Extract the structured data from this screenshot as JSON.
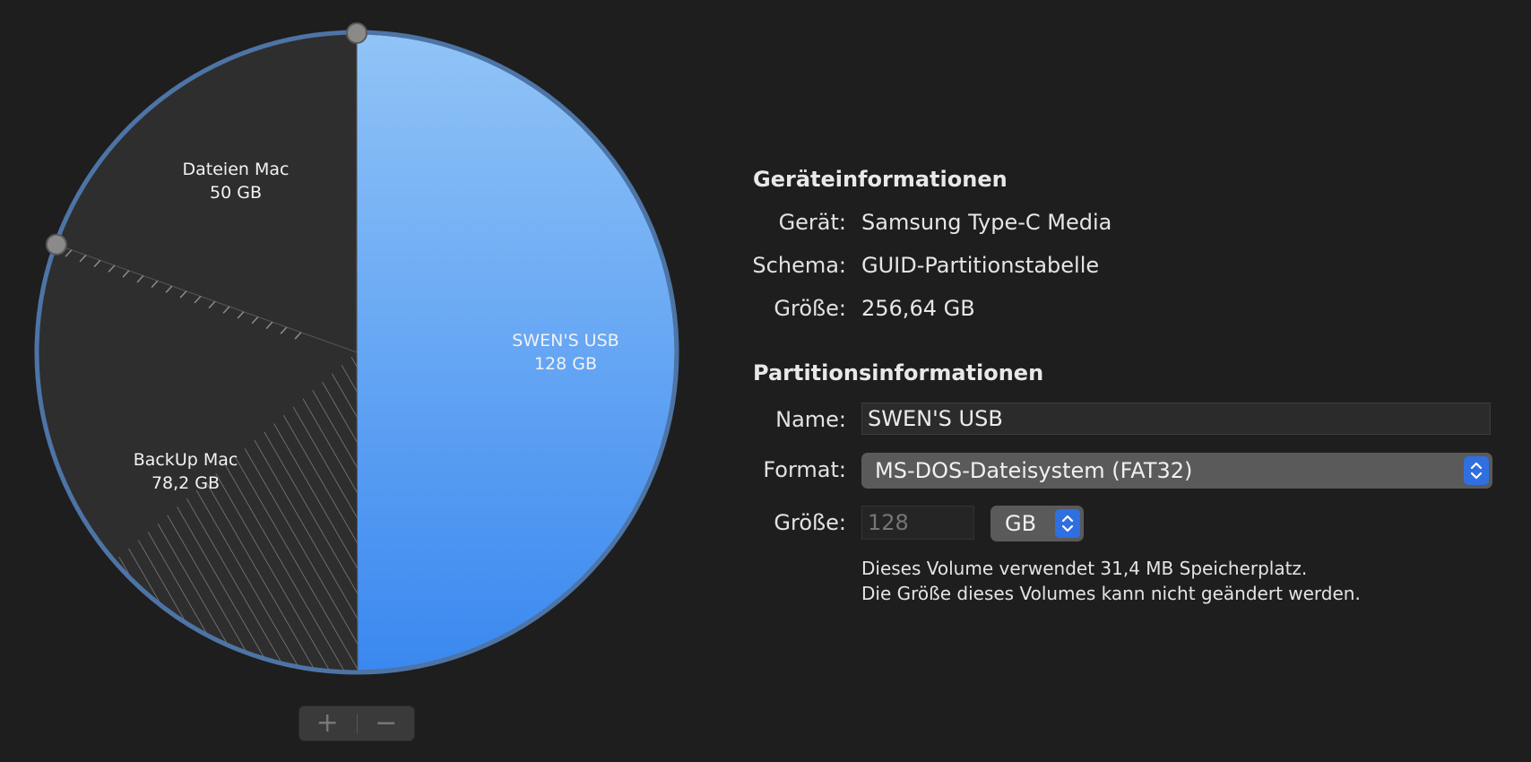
{
  "chart_data": {
    "type": "pie",
    "title": "",
    "slices": [
      {
        "label": "SWEN'S USB",
        "size_label": "128 GB",
        "value": 128,
        "selected": true
      },
      {
        "label": "BackUp Mac",
        "size_label": "78,2 GB",
        "value": 78.2,
        "selected": false
      },
      {
        "label": "Dateien Mac",
        "size_label": "50 GB",
        "value": 50,
        "selected": false
      }
    ],
    "colors": {
      "selected_top": "#91c4f7",
      "selected_bottom": "#3a88f0",
      "unselected": "#2e2e2e",
      "border": "#4d74a6",
      "handle": "#8a8a8a"
    }
  },
  "pie_controls": {
    "add_label": "+",
    "remove_label": "−"
  },
  "device_info": {
    "title": "Geräteinformationen",
    "device_label": "Gerät:",
    "device_value": "Samsung Type-C Media",
    "scheme_label": "Schema:",
    "scheme_value": "GUID-Partitionstabelle",
    "size_label": "Größe:",
    "size_value": "256,64 GB"
  },
  "partition_info": {
    "title": "Partitionsinformationen",
    "name_label": "Name:",
    "name_value": "SWEN'S USB",
    "format_label": "Format:",
    "format_value": "MS-DOS-Dateisystem (FAT32)",
    "size_label": "Größe:",
    "size_placeholder": "128",
    "unit_value": "GB",
    "note_line1": "Dieses Volume verwendet 31,4 MB Speicherplatz.",
    "note_line2": "Die Größe dieses Volumes kann nicht geändert werden."
  },
  "icons": {
    "stepper": "up-down-chevron-icon",
    "add": "plus-icon",
    "remove": "minus-icon"
  }
}
